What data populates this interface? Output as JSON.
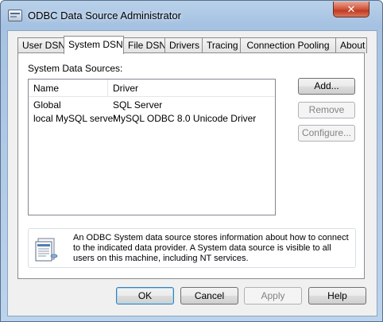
{
  "window": {
    "title": "ODBC Data Source Administrator",
    "close_label": "✕"
  },
  "tabs": [
    {
      "label": "User DSN",
      "active": false
    },
    {
      "label": "System DSN",
      "active": true
    },
    {
      "label": "File DSN",
      "active": false
    },
    {
      "label": "Drivers",
      "active": false
    },
    {
      "label": "Tracing",
      "active": false
    },
    {
      "label": "Connection Pooling",
      "active": false
    },
    {
      "label": "About",
      "active": false
    }
  ],
  "panel": {
    "section_label": "System Data Sources:",
    "columns": {
      "name": "Name",
      "driver": "Driver"
    },
    "rows": [
      {
        "name": "Global",
        "driver": "SQL Server"
      },
      {
        "name": "local MySQL server",
        "driver": "MySQL ODBC 8.0 Unicode Driver"
      }
    ],
    "buttons": {
      "add": "Add...",
      "remove": "Remove",
      "configure": "Configure..."
    },
    "info_text": "An ODBC System data source stores information about how to connect to the indicated data provider.   A System data source is visible to all users on this machine, including NT services."
  },
  "footer": {
    "ok": "OK",
    "cancel": "Cancel",
    "apply": "Apply",
    "help": "Help"
  }
}
